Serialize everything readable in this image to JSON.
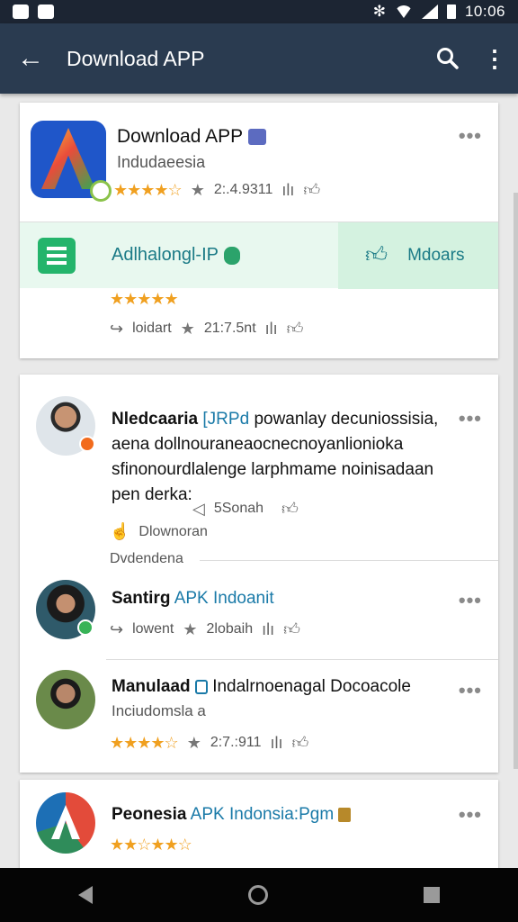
{
  "status": {
    "time": "10:06"
  },
  "appbar": {
    "title": "Download APP",
    "back_icon": "arrow-left-icon",
    "search_icon": "search-icon",
    "menu_icon": "more-vert-icon"
  },
  "featured": {
    "name": "Download APP",
    "subtitle": "Indudaeesia",
    "stars": "★★★★☆",
    "count": "2:.4.9311",
    "band_label": "Adlhalongl-IP",
    "band_action": "Mdoars",
    "row2_stars": "★★★★★",
    "row2_label": "loidart",
    "row2_count": "21:7.5nt"
  },
  "posts": [
    {
      "author": "Nledcaaria",
      "tag": "[JRPd",
      "text_rest": "powanlay decuniossisia, aena dollnouraneaocnecnoyanlionioka sfinonourdlalenge larphmame noinisadaan pen derka:",
      "share_count": "5Sonah",
      "action": "Dlownoran",
      "footer": "Dvdendena"
    },
    {
      "author": "Santirg",
      "tag": "APK Indoanit",
      "action": "lowent",
      "count": "2lobaih"
    },
    {
      "author": "Manulaad",
      "tag": "Indalrnoenagal Docoacole",
      "subtitle": "Inciudomsla a",
      "stars": "★★★★☆",
      "count": "2:7.:911"
    }
  ],
  "last": {
    "title": "Peonesia",
    "tag": "APK Indonsia:Pgm",
    "stars": "★★☆★★☆"
  },
  "colors": {
    "appbar": "#2a3b50",
    "accent_green": "#24b46b",
    "accent_blue": "#1a7aa8",
    "star": "#f0a020"
  }
}
